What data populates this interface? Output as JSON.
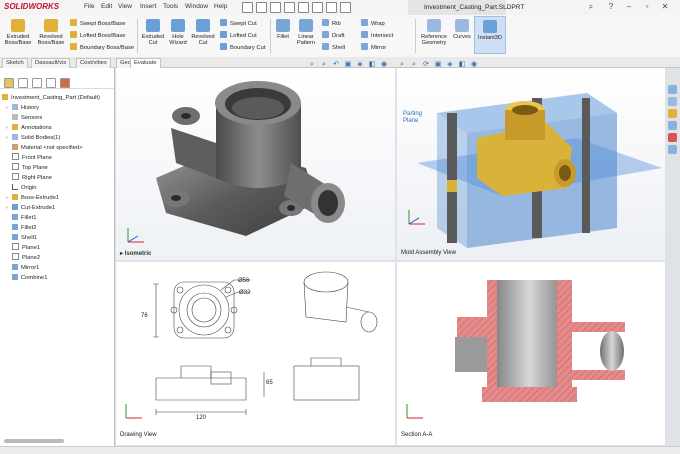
{
  "app": {
    "brand": "SOLIDWORKS",
    "document_title": "Investment_Casting_Part.SLDPRT"
  },
  "menu": [
    "File",
    "Edit",
    "View",
    "Insert",
    "Tools",
    "Window",
    "Help"
  ],
  "ribbon": {
    "extruded_boss": "Extruded\nBoss/Base",
    "revolved_boss": "Revolved\nBoss/Base",
    "swept_boss": "Swept Boss/Base",
    "lofted_boss": "Lofted Boss/Base",
    "boundary_boss": "Boundary Boss/Base",
    "extruded_cut": "Extruded\nCut",
    "hole_wizard": "Hole\nWizard",
    "revolved_cut": "Revolved\nCut",
    "swept_cut": "Swept Cut",
    "lofted_cut": "Lofted Cut",
    "boundary_cut": "Boundary Cut",
    "fillet": "Fillet",
    "linear_pattern": "Linear\nPattern",
    "rib": "Rib",
    "draft": "Draft",
    "shell": "Shell",
    "wrap": "Wrap",
    "intersect": "Intersect",
    "mirror": "Mirror",
    "reference_geometry": "Reference\nGeometry",
    "curves": "Curves",
    "instant3d": "Instant3D"
  },
  "command_tabs": [
    "Sketch",
    "Dassault/vis",
    "Cost/vities",
    "Gec",
    "Evaluate"
  ],
  "tree": {
    "root": "Investment_Casting_Part  (Default)",
    "items": [
      "History",
      "Sensors",
      "Annotations",
      "Solid Bodies(1)",
      "Material <not specified>",
      "Front Plane",
      "Top Plane",
      "Right Plane",
      "Origin",
      "Boss-Extrude1",
      "Cut-Extrude1",
      "Fillet1",
      "Fillet2",
      "Shell1",
      "Plane1",
      "Plane2",
      "Mirror1",
      "Combine1"
    ]
  },
  "viewports": {
    "isometric": "Isometric",
    "mold": "Mold Assembly View",
    "drawing": "Drawing View",
    "section": "Section A-A"
  },
  "annotations": {
    "parting_plane": "Parting\nPlane",
    "dim_d56": "Ø56",
    "dim_d32": "Ø32",
    "dim_76": "76",
    "dim_120": "120",
    "dim_65": "65"
  },
  "colors": {
    "brand_red": "#c8102e",
    "mold_blue": "#3c7fd6",
    "brass": "#d9b23a",
    "section_hatch": "#e58a8a"
  }
}
